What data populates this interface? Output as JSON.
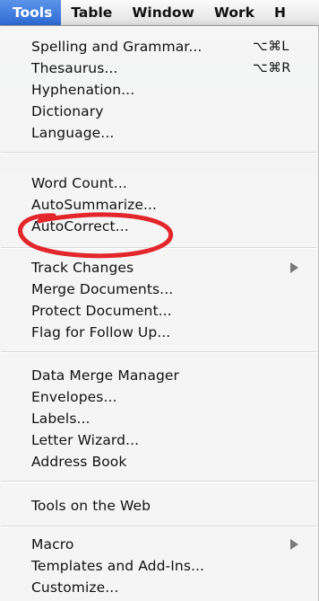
{
  "menubar": {
    "items": [
      "Tools",
      "Table",
      "Window",
      "Work",
      "H"
    ]
  },
  "menu": {
    "spelling": {
      "label": "Spelling and Grammar...",
      "shortcut": "⌥⌘L"
    },
    "thesaurus": {
      "label": "Thesaurus...",
      "shortcut": "⌥⌘R"
    },
    "hyphenation": "Hyphenation...",
    "dictionary": "Dictionary",
    "language": "Language...",
    "word_count": "Word Count...",
    "autosummarize": "AutoSummarize...",
    "autocorrect": "AutoCorrect...",
    "track_changes": "Track Changes",
    "merge_documents": "Merge Documents...",
    "protect_document": "Protect Document...",
    "flag_follow_up": "Flag for Follow Up...",
    "data_merge_manager": "Data Merge Manager",
    "envelopes": "Envelopes...",
    "labels": "Labels...",
    "letter_wizard": "Letter Wizard...",
    "address_book": "Address Book",
    "tools_on_web": "Tools on the Web",
    "macro": "Macro",
    "templates_addins": "Templates and Add-Ins...",
    "customize": "Customize..."
  },
  "colors": {
    "highlight": "#3a75dc",
    "annotation": "#e3262b"
  },
  "icons": {
    "submenu": "triangle-right-icon"
  }
}
